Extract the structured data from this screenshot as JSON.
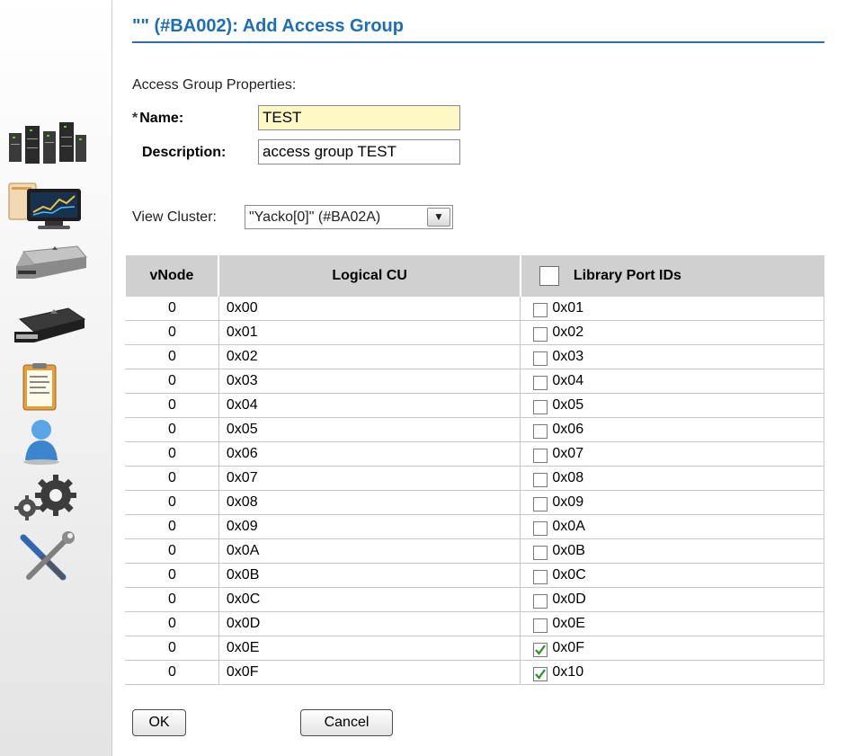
{
  "page": {
    "title": "\"\" (#BA002): Add Access Group",
    "properties_heading": "Access Group Properties:"
  },
  "form": {
    "required_marker": "*",
    "name_label": "Name:",
    "name_value": "TEST",
    "description_label": "Description:",
    "description_value": "access group TEST"
  },
  "cluster": {
    "label": "View Cluster:",
    "selected": "\"Yacko[0]\" (#BA02A)"
  },
  "table": {
    "columns": [
      "vNode",
      "Logical CU",
      "Library Port IDs"
    ],
    "select_all_checked": false,
    "rows": [
      {
        "vnode": "0",
        "lcu": "0x00",
        "port": "0x01",
        "checked": false
      },
      {
        "vnode": "0",
        "lcu": "0x01",
        "port": "0x02",
        "checked": false
      },
      {
        "vnode": "0",
        "lcu": "0x02",
        "port": "0x03",
        "checked": false
      },
      {
        "vnode": "0",
        "lcu": "0x03",
        "port": "0x04",
        "checked": false
      },
      {
        "vnode": "0",
        "lcu": "0x04",
        "port": "0x05",
        "checked": false
      },
      {
        "vnode": "0",
        "lcu": "0x05",
        "port": "0x06",
        "checked": false
      },
      {
        "vnode": "0",
        "lcu": "0x06",
        "port": "0x07",
        "checked": false
      },
      {
        "vnode": "0",
        "lcu": "0x07",
        "port": "0x08",
        "checked": false
      },
      {
        "vnode": "0",
        "lcu": "0x08",
        "port": "0x09",
        "checked": false
      },
      {
        "vnode": "0",
        "lcu": "0x09",
        "port": "0x0A",
        "checked": false
      },
      {
        "vnode": "0",
        "lcu": "0x0A",
        "port": "0x0B",
        "checked": false
      },
      {
        "vnode": "0",
        "lcu": "0x0B",
        "port": "0x0C",
        "checked": false
      },
      {
        "vnode": "0",
        "lcu": "0x0C",
        "port": "0x0D",
        "checked": false
      },
      {
        "vnode": "0",
        "lcu": "0x0D",
        "port": "0x0E",
        "checked": false
      },
      {
        "vnode": "0",
        "lcu": "0x0E",
        "port": "0x0F",
        "checked": true
      },
      {
        "vnode": "0",
        "lcu": "0x0F",
        "port": "0x10",
        "checked": true
      }
    ]
  },
  "buttons": {
    "ok": "OK",
    "cancel": "Cancel"
  },
  "sidebar": {
    "icons": [
      "cluster-icon",
      "monitor-icon",
      "appliance-icon",
      "drive-icon",
      "clipboard-icon",
      "user-icon",
      "gears-icon",
      "tools-icon"
    ]
  },
  "colors": {
    "title": "#1d6fb5",
    "title_rule": "#2d6fb6",
    "name_field_bg": "#fdf8c4",
    "table_header_bg": "#d0d0d0",
    "check_green": "#2e8b2e"
  }
}
